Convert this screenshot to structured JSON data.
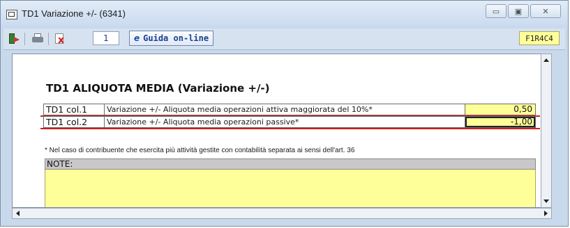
{
  "window": {
    "title": "TD1 Variazione +/- (6341)",
    "controls": {
      "minimize": "▭",
      "maximize": "▣",
      "close": "✕"
    }
  },
  "toolbar": {
    "page_number": "1",
    "help_label": "Guida on-line",
    "help_icon": "e",
    "cell_code": "F1R4C4"
  },
  "form": {
    "heading": "TD1 ALIQUOTA MEDIA  (Variazione +/-)",
    "rows": [
      {
        "code": "TD1 col.1",
        "description": "Variazione +/- Aliquota media operazioni attiva maggiorata del 10%*",
        "value": "0,50"
      },
      {
        "code": "TD1 col.2",
        "description": "Variazione +/- Aliquota media operazioni passive*",
        "value": "-1,00"
      }
    ],
    "footnote": "* Nel caso di contribuente che esercita più attività gestite con contabilità separata ai sensi dell'art. 36",
    "notes_label": "NOTE:",
    "notes_value": ""
  },
  "colors": {
    "input_bg": "#ffff99",
    "highlight": "#d11d1d",
    "chrome": "#c9d9ec"
  }
}
